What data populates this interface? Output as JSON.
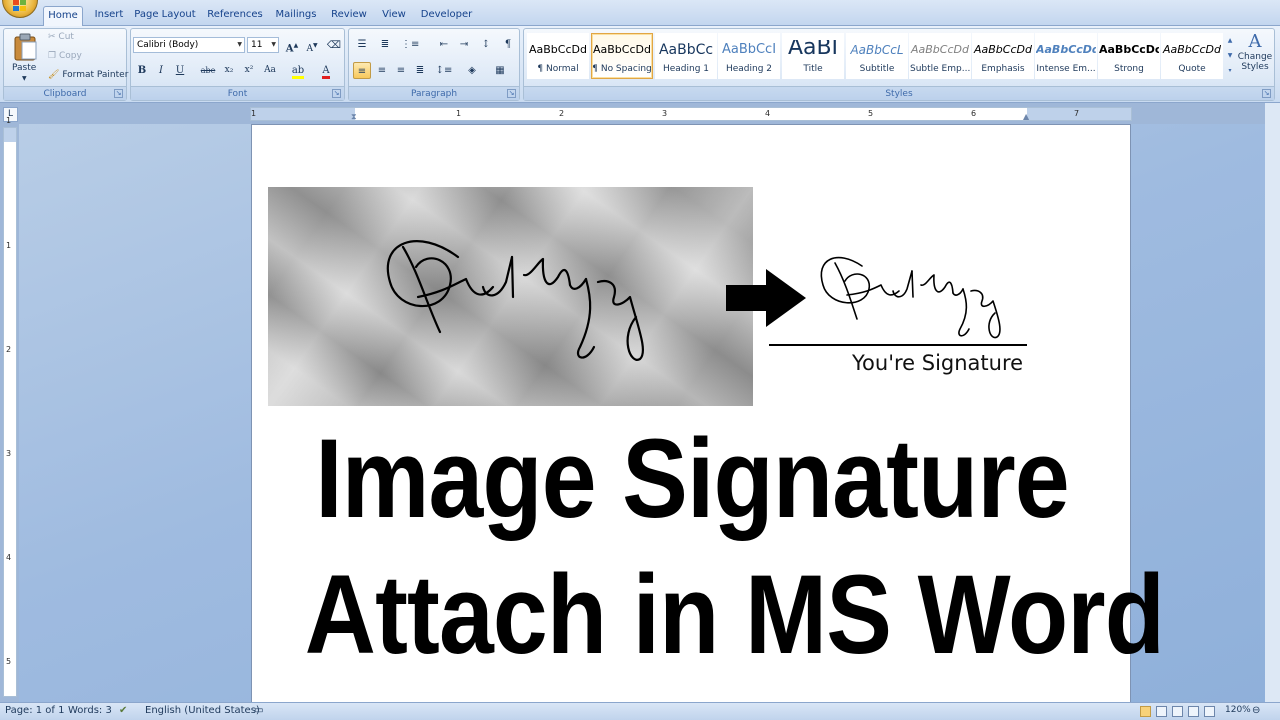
{
  "tabs": [
    {
      "label": "Home",
      "active": true
    },
    {
      "label": "Insert"
    },
    {
      "label": "Page Layout"
    },
    {
      "label": "References"
    },
    {
      "label": "Mailings"
    },
    {
      "label": "Review"
    },
    {
      "label": "View"
    },
    {
      "label": "Developer"
    }
  ],
  "clipboard": {
    "paste_label": "Paste",
    "cut_label": "Cut",
    "copy_label": "Copy",
    "format_painter_label": "Format Painter",
    "group_label": "Clipboard"
  },
  "font": {
    "family": "Calibri (Body)",
    "size": "11",
    "group_label": "Font",
    "bold": "B",
    "italic": "I",
    "underline": "U",
    "strike": "abe",
    "subscript": "x₂",
    "superscript": "x²",
    "change_case": "Aa",
    "font_color": "A",
    "grow": "A",
    "shrink": "A"
  },
  "paragraph": {
    "group_label": "Paragraph",
    "pilcrow": "¶"
  },
  "styles": {
    "group_label": "Styles",
    "items": [
      {
        "preview": "AaBbCcDd",
        "name": "¶ Normal"
      },
      {
        "preview": "AaBbCcDd",
        "name": "¶ No Spacing",
        "selected": true
      },
      {
        "preview": "AaBbCc",
        "name": "Heading 1"
      },
      {
        "preview": "AaBbCcI",
        "name": "Heading 2"
      },
      {
        "preview": "AaBI",
        "name": "Title"
      },
      {
        "preview": "AaBbCcL",
        "name": "Subtitle"
      },
      {
        "preview": "AaBbCcDd",
        "name": "Subtle Emp..."
      },
      {
        "preview": "AaBbCcDd",
        "name": "Emphasis"
      },
      {
        "preview": "AaBbCcDd",
        "name": "Intense Em..."
      },
      {
        "preview": "AaBbCcDc",
        "name": "Strong"
      },
      {
        "preview": "AaBbCcDd",
        "name": "Quote"
      }
    ],
    "change_styles_line1": "Change",
    "change_styles_line2": "Styles"
  },
  "ruler": {
    "corner": "L",
    "h_numbers": [
      "1",
      "1",
      "2",
      "3",
      "4",
      "5",
      "6",
      "7"
    ],
    "v_numbers": [
      "1",
      "1",
      "2",
      "3",
      "4",
      "5"
    ]
  },
  "document": {
    "signature_caption": "You're Signature",
    "headline_line1": "Image Signature",
    "headline_line2": "Attach in MS Word"
  },
  "status": {
    "page": "Page: 1 of 1",
    "words": "Words: 3",
    "language": "English (United States)",
    "zoom": "120%"
  },
  "colors": {
    "ribbon_text": "#15428b",
    "selected_style_border": "#e1a644",
    "doc_background": "#9fbbe0"
  }
}
